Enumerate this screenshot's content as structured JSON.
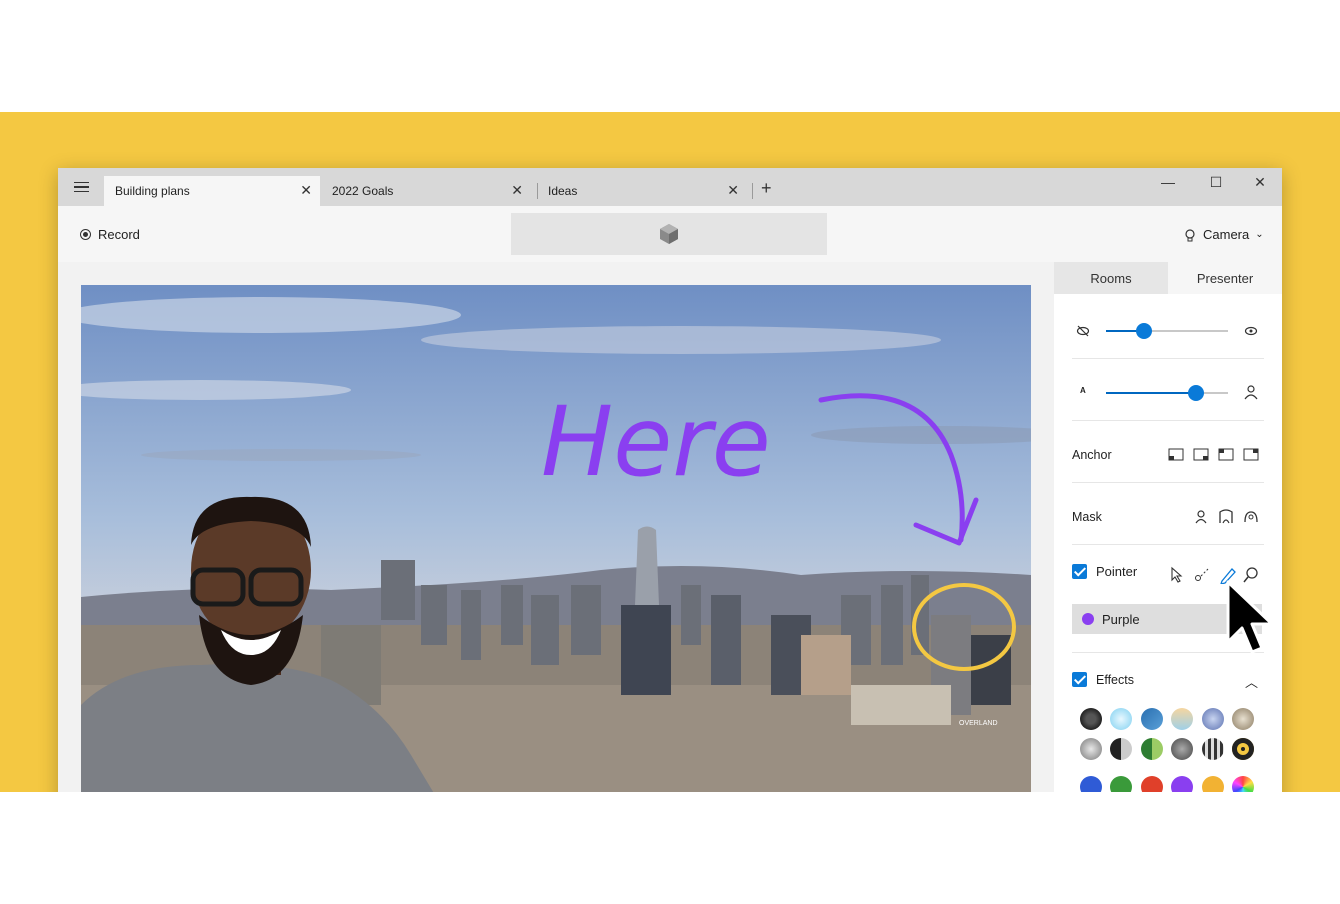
{
  "tabs": [
    {
      "label": "Building plans",
      "active": true
    },
    {
      "label": "2022 Goals",
      "active": false
    },
    {
      "label": "Ideas",
      "active": false
    }
  ],
  "toolbar": {
    "record_label": "Record",
    "camera_label": "Camera"
  },
  "canvas": {
    "ink_text": "Here",
    "sign_text": "OVERLAND",
    "ink_color": "#8a3ff0",
    "circle_color": "#f4c842"
  },
  "panel": {
    "tabs": [
      {
        "label": "Rooms"
      },
      {
        "label": "Presenter"
      }
    ],
    "slider_visibility": 0.31,
    "slider_size": 0.74,
    "anchor_label": "Anchor",
    "mask_label": "Mask",
    "pointer": {
      "label": "Pointer",
      "checked": true,
      "selected_color": "Purple"
    },
    "effects": {
      "label": "Effects",
      "checked": true
    }
  },
  "colors": {
    "background_band": "#f4c842",
    "accent": "#0a7ad8",
    "purple": "#8a3ff0"
  }
}
